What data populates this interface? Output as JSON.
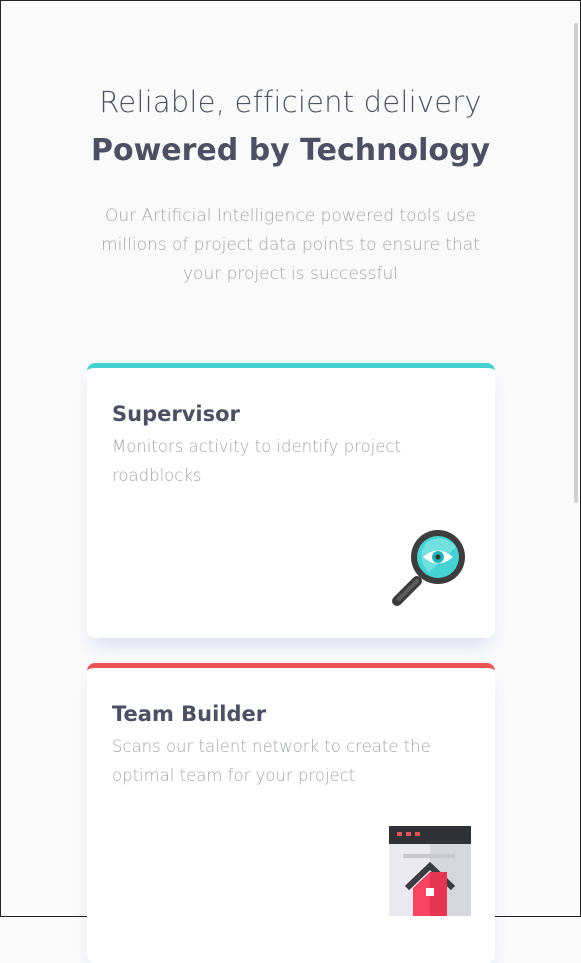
{
  "header": {
    "subtitle": "Reliable, efficient delivery",
    "title": "Powered by Technology",
    "description": "Our Artificial Intelligence powered tools use millions of project data points to ensure that your project is successful"
  },
  "cards": [
    {
      "title": "Supervisor",
      "description": "Monitors activity to identify project roadblocks",
      "accent_color": "#44d3d2",
      "icon": "magnifier-eye-icon"
    },
    {
      "title": "Team Builder",
      "description": "Scans our talent network to create the optimal team for your project",
      "accent_color": "#ea5454",
      "icon": "team-builder-window-icon"
    }
  ]
}
